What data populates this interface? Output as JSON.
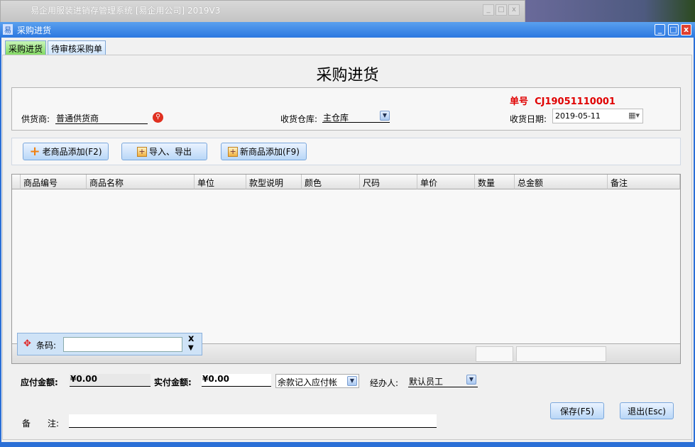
{
  "background_window": {
    "title": "易企用服装进销存管理系统 [易企用公司] 2019V3"
  },
  "window": {
    "title": "采购进货"
  },
  "tabs": [
    {
      "label": "采购进货",
      "active": true
    },
    {
      "label": "待审核采购单",
      "active": false
    }
  ],
  "form": {
    "heading": "采购进货",
    "order_no_label": "单号",
    "order_no": "CJ19051110001",
    "supplier_label": "供货商:",
    "supplier": "普通供货商",
    "warehouse_label": "收货仓库:",
    "warehouse": "主仓库",
    "date_label": "收货日期:",
    "date": "2019-05-11"
  },
  "toolbar": {
    "old_add": "老商品添加(F2)",
    "import_export": "导入、导出",
    "new_add": "新商品添加(F9)"
  },
  "grid": {
    "columns": [
      "商品编号",
      "商品名称",
      "单位",
      "款型说明",
      "颜色",
      "尺码",
      "单价",
      "数量",
      "总金额",
      "备注"
    ],
    "rows": []
  },
  "barcode": {
    "label": "条码:",
    "value": "",
    "close": "x",
    "expand": "▼"
  },
  "footer": {
    "payable_label": "应付金额:",
    "payable": "¥0.00",
    "paid_label": "实付金额:",
    "paid": "¥0.00",
    "balance_mode": "余款记入应付帐",
    "handler_label": "经办人:",
    "handler": "默认员工",
    "remark_label": "备　　注:",
    "remark": "",
    "save": "保存(F5)",
    "exit": "退出(Esc)"
  },
  "colors": {
    "titlebar": "#2c78e0",
    "order_no": "#e00000",
    "active_tab": "#8ee07a"
  }
}
